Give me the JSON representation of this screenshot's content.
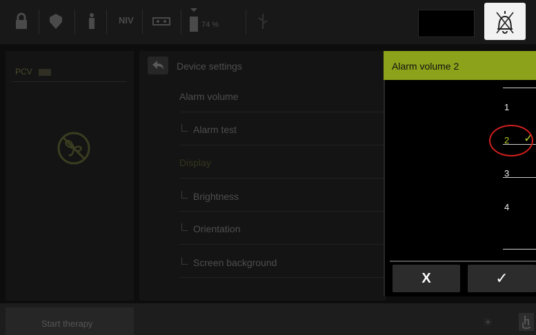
{
  "topbar": {
    "mode_label": "NIV",
    "battery_percent": "74 %",
    "icons": [
      "lock-icon",
      "shield-icon",
      "person-icon",
      "cassette-icon",
      "battery-icon",
      "usb-icon",
      "alarm-off-icon"
    ]
  },
  "left_panel": {
    "mode": "PCV",
    "status_icon": "ventilation-off-icon"
  },
  "settings": {
    "heading": "Device settings",
    "items": [
      {
        "label": "Alarm volume",
        "sub": false
      },
      {
        "label": "Alarm test",
        "sub": true
      },
      {
        "label": "Display",
        "sub": false
      },
      {
        "label": "Brightness",
        "sub": true
      },
      {
        "label": "Orientation",
        "sub": true
      },
      {
        "label": "Screen background",
        "sub": true
      }
    ]
  },
  "dialog": {
    "title": "Alarm volume 2",
    "options": [
      "1",
      "2",
      "3",
      "4"
    ],
    "selected": "2",
    "cancel_label": "X",
    "confirm_label": "✓"
  },
  "bottombar": {
    "start_label": "Start therapy"
  },
  "colors": {
    "accent": "#8ca21a",
    "highlight_circle": "#d41f1f"
  }
}
